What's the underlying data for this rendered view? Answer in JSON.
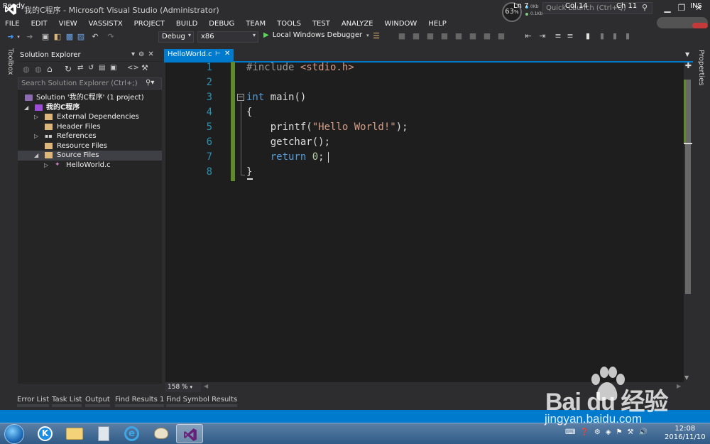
{
  "window": {
    "title": "我的C程序 - Microsoft Visual Studio (Administrator)",
    "perf_percent": "63",
    "perf_unit": "%",
    "net_up": "0Kb",
    "net_down": "0.1Kb",
    "quick_launch_placeholder": "Quick Launch (Ctrl+Q)",
    "minimize": "▁",
    "restore": "❐",
    "close": "✕"
  },
  "menu": [
    "FILE",
    "EDIT",
    "VIEW",
    "VASSISTX",
    "PROJECT",
    "BUILD",
    "DEBUG",
    "TEAM",
    "TOOLS",
    "TEST",
    "ANALYZE",
    "WINDOW",
    "HELP"
  ],
  "toolbar": {
    "config": "Debug",
    "platform": "x86",
    "debugger": "Local Windows Debugger"
  },
  "side_tabs": {
    "toolbox": "Toolbox",
    "properties": "Properties"
  },
  "solution_explorer": {
    "title": "Solution Explorer",
    "search_placeholder": "Search Solution Explorer (Ctrl+;)",
    "tree": {
      "solution": "Solution '我的C程序' (1 project)",
      "project": "我的C程序",
      "external_deps": "External Dependencies",
      "header_files": "Header Files",
      "references": "References",
      "resource_files": "Resource Files",
      "source_files": "Source Files",
      "hello_file": "HelloWorld.c"
    }
  },
  "editor": {
    "tab_label": "HelloWorld.c",
    "zoom": "158 %",
    "line_numbers": [
      "1",
      "2",
      "3",
      "4",
      "5",
      "6",
      "7",
      "8"
    ]
  },
  "bottom_tabs": {
    "error_list": "Error List",
    "task_list": "Task List",
    "output": "Output",
    "find_results_1": "Find Results 1",
    "find_symbol_results": "Find Symbol Results"
  },
  "status": {
    "ready": "Ready",
    "line": "Ln 7",
    "col": "Col 14",
    "ch": "Ch 11",
    "ins": "INS"
  },
  "taskbar": {
    "time": "12:08",
    "date": "2016/11/10"
  },
  "watermark": {
    "brand": "Bai du 经验",
    "url": "jingyan.baidu.com"
  },
  "colors": {
    "accent": "#007acc",
    "editor_bg": "#1e1e1e",
    "keyword": "#569cd6",
    "string": "#d69d85",
    "line_number": "#2b91af",
    "change_bar": "#5e8a2c"
  }
}
